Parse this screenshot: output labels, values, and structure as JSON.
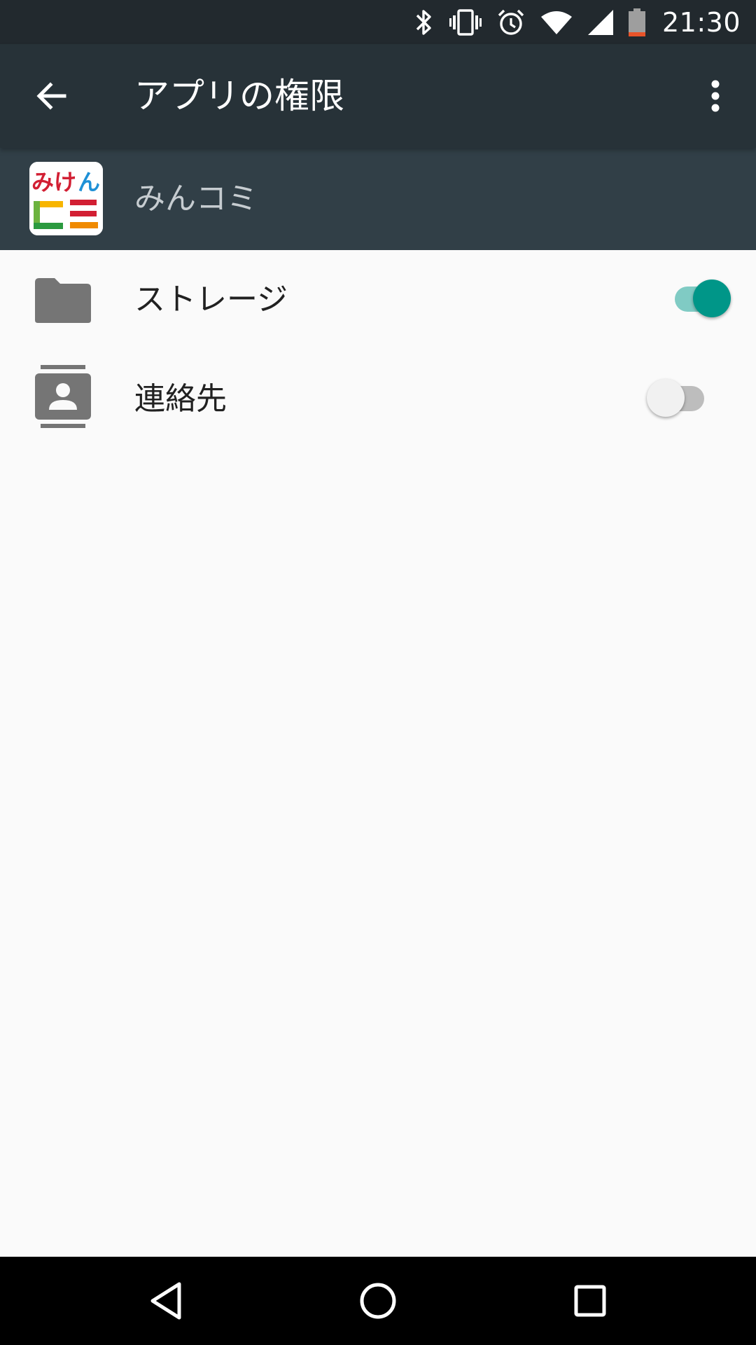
{
  "status_bar": {
    "time": "21:30",
    "icons": [
      "bluetooth-icon",
      "vibrate-icon",
      "alarm-icon",
      "wifi-icon",
      "cell-signal-icon",
      "battery-icon"
    ],
    "battery_accent_color": "#e8542a"
  },
  "toolbar": {
    "title": "アプリの権限",
    "background_color": "#273238"
  },
  "app": {
    "name": "みんコミ",
    "header_color": "#313f47",
    "icon_text_top": "みけん",
    "icon_text_bottom": "コミ"
  },
  "permissions": [
    {
      "label": "ストレージ",
      "icon": "folder-icon",
      "enabled": true
    },
    {
      "label": "連絡先",
      "icon": "contacts-icon",
      "enabled": false
    }
  ],
  "colors": {
    "accent": "#009688",
    "accent_track": "#80cbc4",
    "background": "#fafafa"
  },
  "nav_bar": {
    "buttons": [
      "back-triangle-icon",
      "home-circle-icon",
      "recents-square-icon"
    ]
  }
}
